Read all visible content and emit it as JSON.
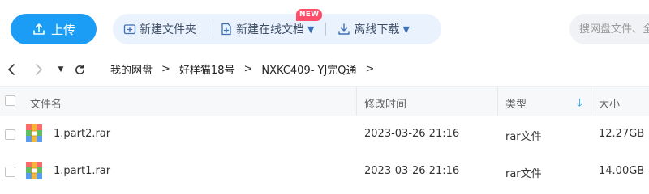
{
  "toolbar": {
    "upload_label": "上传",
    "actions": [
      {
        "label": "新建文件夹",
        "icon": "folder-plus-icon"
      },
      {
        "label": "新建在线文档",
        "icon": "doc-plus-icon"
      },
      {
        "label": "离线下载",
        "icon": "download-icon"
      }
    ],
    "new_badge": "NEW",
    "search_placeholder": "搜网盘文件、全"
  },
  "nav": {
    "breadcrumbs": [
      "我的网盘",
      "好样猫18号",
      "NXKC409- YJ完Q通"
    ]
  },
  "table": {
    "headers": {
      "name": "文件名",
      "modified": "修改时间",
      "type": "类型",
      "size": "大小"
    },
    "rows": [
      {
        "name": "1.part2.rar",
        "modified": "2023-03-26 21:16",
        "type": "rar文件",
        "size": "12.27GB"
      },
      {
        "name": "1.part1.rar",
        "modified": "2023-03-26 21:16",
        "type": "rar文件",
        "size": "14.00GB"
      }
    ]
  },
  "colors": {
    "accent": "#1b9df5",
    "badge": "#ff4d6a",
    "action_bg": "#eaf3fd"
  }
}
